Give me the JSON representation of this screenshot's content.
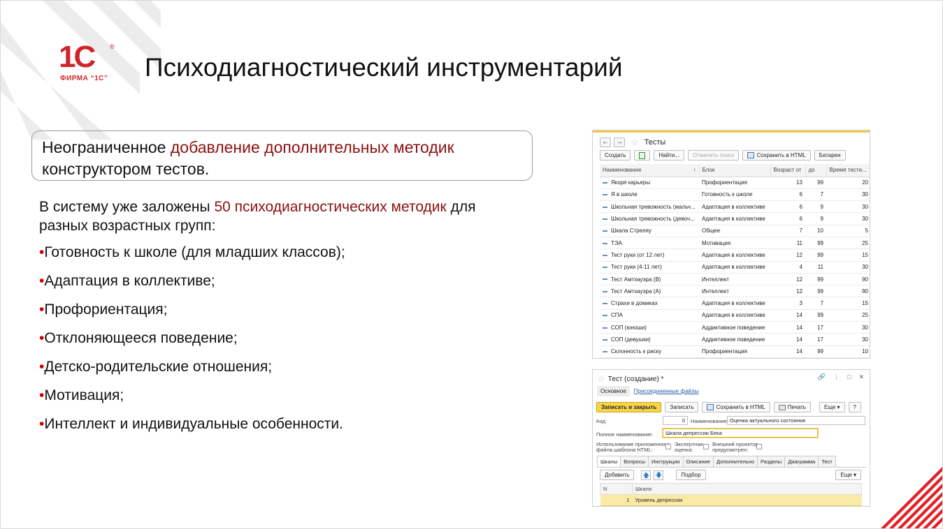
{
  "slide": {
    "title": "Психодиагностический инструментарий",
    "logo": {
      "main": "1С",
      "reg": "®",
      "sub": "ФИРМА “1С”"
    },
    "callout": {
      "part1": "Неограниченное ",
      "highlight": "добавление дополнительных методик",
      "part2": "конструктором тестов."
    },
    "intro": {
      "part1": "В систему уже заложены ",
      "highlight": "50 психодиагностических методик",
      "part2": " для разных возрастных групп:"
    },
    "bullet_mark": "•",
    "bullets": [
      "Готовность к школе (для младших классов);",
      "Адаптация в коллективе;",
      "Профориентация;",
      "Отклоняющееся поведение;",
      "Детско-родительские отношения;",
      "Мотивация;",
      "Интеллект и индивидуальные особенности."
    ],
    "colors": {
      "accent_red": "#d1232a",
      "highlight_text": "#8b1010",
      "bullet_dot": "#cc0000"
    }
  },
  "tests_window": {
    "nav_back": "←",
    "nav_forward": "→",
    "star": "☆",
    "title": "Тесты",
    "toolbar": {
      "create": "Создать",
      "find": "Найти...",
      "cancel_search": "Отменить поиск",
      "save_html": "Сохранить в HTML",
      "batteries": "Батареи"
    },
    "columns": {
      "name": "Наименование",
      "sort_mark": "↑",
      "block": "Блок",
      "age_from": "Возраст от",
      "age_to": "до",
      "time": "Время тести..."
    },
    "rows": [
      {
        "name": "Якоря карьеры",
        "block": "Профориентация",
        "from": "13",
        "to": "99",
        "time": "20"
      },
      {
        "name": "Я в школе",
        "block": "Готовность к школе",
        "from": "6",
        "to": "7",
        "time": "30"
      },
      {
        "name": "Школьная тревожность (мальч...",
        "block": "Адаптация в коллективе",
        "from": "6",
        "to": "9",
        "time": "30"
      },
      {
        "name": "Школьная тревожность (девоч...",
        "block": "Адаптация в коллективе",
        "from": "6",
        "to": "9",
        "time": "30"
      },
      {
        "name": "Шкала Стреляу",
        "block": "Общее",
        "from": "7",
        "to": "10",
        "time": "5"
      },
      {
        "name": "ТЭА",
        "block": "Мотивация",
        "from": "11",
        "to": "99",
        "time": "25"
      },
      {
        "name": "Тест руки (от 12 лет)",
        "block": "Адаптация в коллективе",
        "from": "12",
        "to": "99",
        "time": "15"
      },
      {
        "name": "Тест руки (4-11 лет)",
        "block": "Адаптация в коллективе",
        "from": "4",
        "to": "11",
        "time": "30"
      },
      {
        "name": "Тест Амтхауэра (В)",
        "block": "Интеллект",
        "from": "12",
        "to": "99",
        "time": "90"
      },
      {
        "name": "Тест Амтхауэра (А)",
        "block": "Интеллект",
        "from": "12",
        "to": "99",
        "time": "90"
      },
      {
        "name": "Страхи в домиках",
        "block": "Адаптация в коллективе",
        "from": "3",
        "to": "7",
        "time": "15"
      },
      {
        "name": "СПА",
        "block": "Адаптация в коллективе",
        "from": "14",
        "to": "99",
        "time": "25"
      },
      {
        "name": "СОП (юноши)",
        "block": "Аддиктивное поведение",
        "from": "14",
        "to": "17",
        "time": "30"
      },
      {
        "name": "СОП (девушки)",
        "block": "Аддиктивное поведение",
        "from": "14",
        "to": "17",
        "time": "30"
      },
      {
        "name": "Склонность к риску",
        "block": "Профориентация",
        "from": "14",
        "to": "99",
        "time": "10"
      }
    ]
  },
  "test_form": {
    "star": "☆",
    "title": "Тест (создание) *",
    "controls": {
      "link": "🔗",
      "menu": "⋮",
      "restore": "□",
      "close": "✕"
    },
    "top_tabs": {
      "main": "Основное",
      "files": "Присоединенные файлы"
    },
    "toolbar": {
      "save_close": "Записать и закрыть",
      "save": "Записать",
      "save_html": "Сохранить в HTML",
      "print": "Печать",
      "more": "Еще ▾",
      "help": "?"
    },
    "fields": {
      "code_label": "Код:",
      "code_value": "0",
      "name_label": "Наименование:",
      "name_value": "Оценка актуального состояния",
      "full_name_label": "Полное наименование:",
      "full_name_value": "Шкала депрессии Бека",
      "html_label_1": "Использование приложенного",
      "html_label_2": "файла шаблона HTML:",
      "expert_label_1": "Экспертная",
      "expert_label_2": "оценка:",
      "projector_label_1": "Внешний проектор",
      "projector_label_2": "предусмотрен:"
    },
    "tabs": [
      "Шкалы",
      "Вопросы",
      "Инструкции",
      "Описание",
      "Дополнительно",
      "Разделы",
      "Диаграмма",
      "Тест"
    ],
    "scales_toolbar": {
      "add": "Добавить",
      "up": "🡅",
      "down": "🡇",
      "pick": "Подбор",
      "more": "Еще ▾"
    },
    "scales_columns": {
      "n": "N",
      "scale": "Шкала"
    },
    "scales_rows": [
      {
        "n": "1",
        "scale": "Уровень депрессии"
      }
    ]
  }
}
